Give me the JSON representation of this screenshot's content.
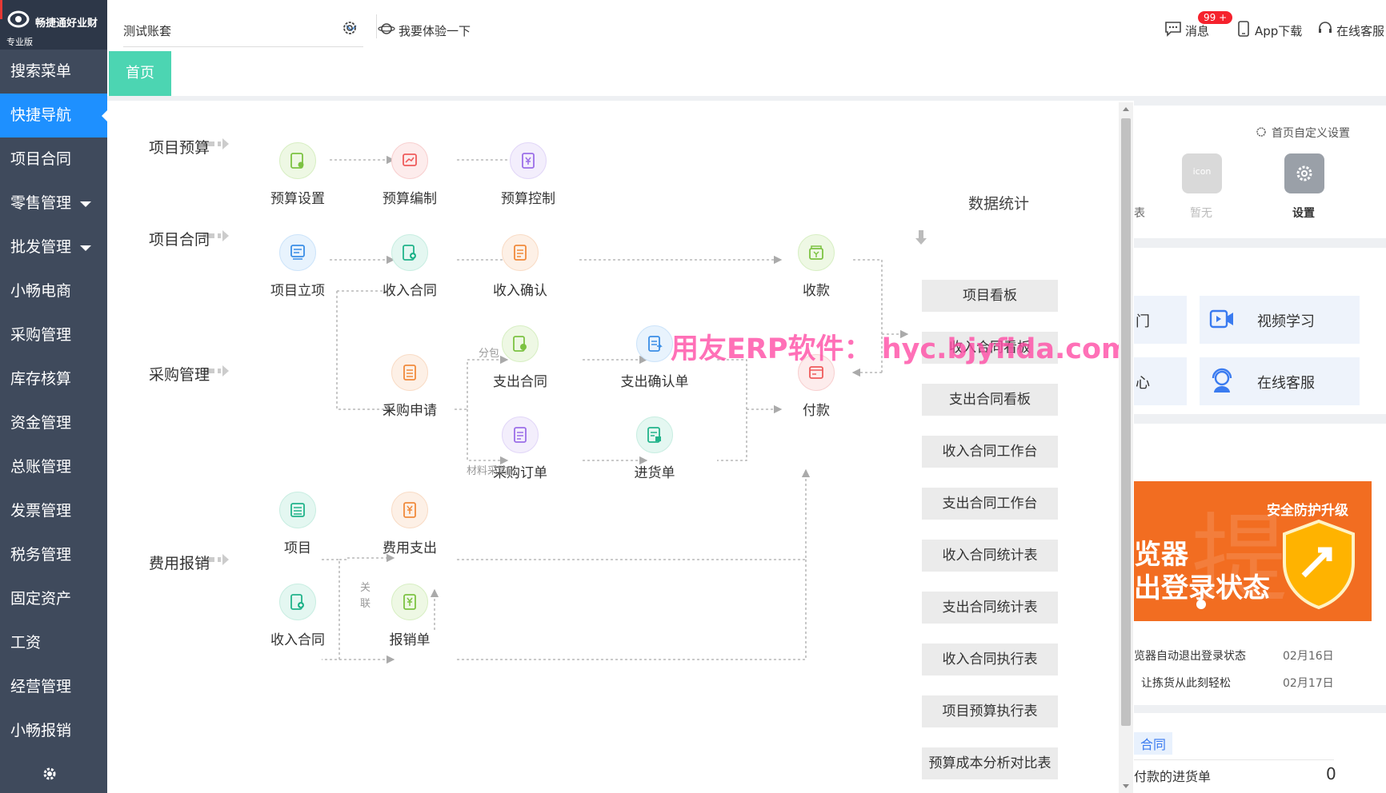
{
  "app": {
    "brand": "畅捷通好业财",
    "edition": "专业版"
  },
  "sidebar": {
    "items": [
      {
        "label": "搜索菜单"
      },
      {
        "label": "快捷导航",
        "active": true
      },
      {
        "label": "项目合同"
      },
      {
        "label": "零售管理",
        "has_caret": true
      },
      {
        "label": "批发管理",
        "has_caret": true
      },
      {
        "label": "小畅电商"
      },
      {
        "label": "采购管理"
      },
      {
        "label": "库存核算"
      },
      {
        "label": "资金管理"
      },
      {
        "label": "总账管理"
      },
      {
        "label": "发票管理"
      },
      {
        "label": "税务管理"
      },
      {
        "label": "固定资产"
      },
      {
        "label": "工资"
      },
      {
        "label": "经营管理"
      },
      {
        "label": "小畅报销"
      }
    ],
    "bottom_icon": "gear-icon"
  },
  "topbar": {
    "account_value": "测试账套",
    "experience_label": "我要体验一下",
    "messages_label": "消息",
    "messages_badge": "99 +",
    "app_download_label": "App下载",
    "online_service_label": "在线客服"
  },
  "tabs": [
    {
      "label": "首页",
      "active": true
    }
  ],
  "background_widgets": {
    "custom_settings_label": "首页自定义设置",
    "report_fragment": "表",
    "empty_label": "暂无",
    "icon_placeholder": "icon",
    "settings_label": "设置",
    "door_fragment": "门",
    "heart_fragment": "心",
    "video_label": "视频学习",
    "service_label": "在线客服",
    "banner_tag": "安全防护升级",
    "banner_line1": "览器",
    "banner_line2": "出登录状态",
    "banner_bg_char": "提",
    "news": [
      {
        "title": "览器自动退出登录状态",
        "date": "02月16日"
      },
      {
        "title": "让拣货从此刻轻松",
        "date": "02月17日"
      }
    ],
    "contract_tab": "合同",
    "pending_label": "付款的进货单",
    "pending_count": "0"
  },
  "flow": {
    "rows": {
      "budget": "项目预算",
      "contract": "项目合同",
      "purchase": "采购管理",
      "expense": "费用报销"
    },
    "nodes": {
      "budget_setup": "预算设置",
      "budget_compile": "预算编制",
      "budget_control": "预算控制",
      "project_setup": "项目立项",
      "income_contract": "收入合同",
      "income_confirm": "收入确认",
      "receipt": "收款",
      "expense_contract": "支出合同",
      "expense_confirm": "支出确认单",
      "purchase_request": "采购申请",
      "purchase_order": "采购订单",
      "goods_receipt": "进货单",
      "payment": "付款",
      "project": "项目",
      "expense_out": "费用支出",
      "income_contract_2": "收入合同",
      "reimburse": "报销单"
    },
    "line_labels": {
      "subcontract": "分包",
      "material": "材料采购",
      "relate": "关联"
    },
    "stats_title": "数据统计",
    "stats": [
      "项目看板",
      "收入合同看板",
      "支出合同看板",
      "收入合同工作台",
      "支出合同工作台",
      "收入合同统计表",
      "支出合同统计表",
      "收入合同执行表",
      "项目预算执行表",
      "预算成本分析对比表"
    ]
  },
  "watermark": "用友ERP软件： hyc.bjyfida.com",
  "colors": {
    "sidebar_bg": "#3f4a5c",
    "sidebar_active": "#1e90ff",
    "tab_active": "#4cd5b2",
    "badge": "#f5222d",
    "banner": "#f26d21"
  }
}
